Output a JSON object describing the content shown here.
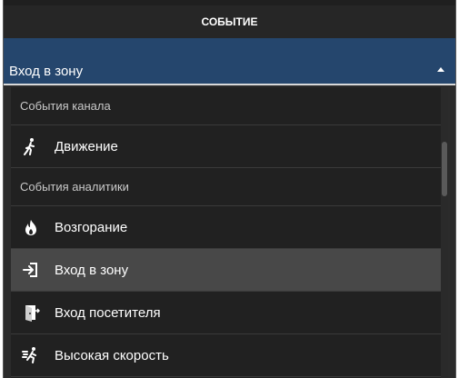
{
  "header": {
    "title": "СОБЫТИЕ"
  },
  "select": {
    "value": "Вход в зону"
  },
  "dropdown": {
    "groups": [
      {
        "label": "События канала",
        "items": [
          {
            "label": "Движение",
            "icon": "walking-person-icon"
          }
        ]
      },
      {
        "label": "События аналитики",
        "items": [
          {
            "label": "Возгорание",
            "icon": "fire-icon"
          },
          {
            "label": "Вход в зону",
            "icon": "enter-zone-icon",
            "selected": true
          },
          {
            "label": "Вход посетителя",
            "icon": "visitor-entrance-icon"
          },
          {
            "label": "Высокая скорость",
            "icon": "running-fast-icon"
          }
        ]
      }
    ]
  },
  "colors": {
    "select_background": "#25466d",
    "selected_item_background": "#484848"
  }
}
